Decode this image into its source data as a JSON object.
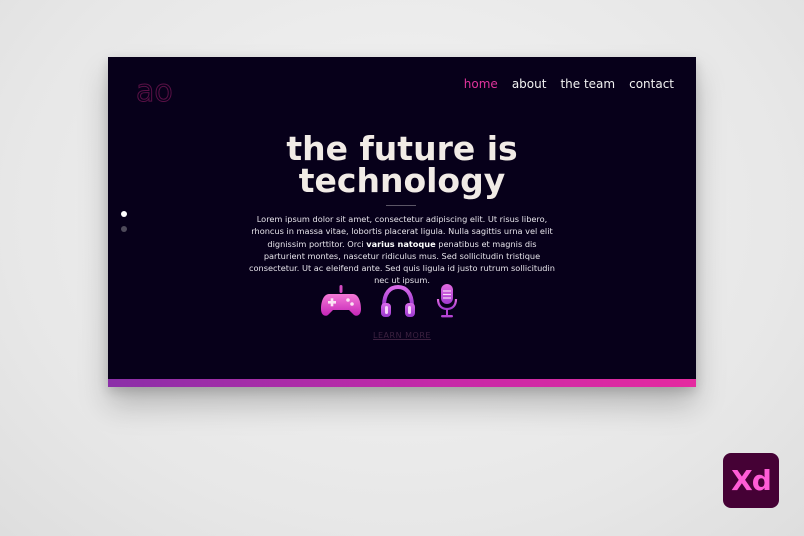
{
  "logo": {
    "text": "ao"
  },
  "nav": {
    "items": [
      {
        "label": "home",
        "active": true
      },
      {
        "label": "about",
        "active": false
      },
      {
        "label": "the team",
        "active": false
      },
      {
        "label": "contact",
        "active": false
      }
    ]
  },
  "hero": {
    "headline_line1": "the future is",
    "headline_line2": "technology",
    "body_part1": "Lorem ipsum dolor sit amet, consectetur adipiscing elit. Ut risus libero, rhoncus in massa vitae, lobortis placerat ligula. Nulla sagittis urna vel elit dignissim porttitor. Orci ",
    "body_bold": "varius natoque",
    "body_part2": " penatibus et magnis dis parturient montes, nascetur ridiculus mus. Sed sollicitudin tristique consectetur. Ut ac eleifend ante. Sed quis ligula id justo rutrum sollicitudin nec ut ipsum.",
    "cta_label": "LEARN MORE"
  },
  "slider": {
    "count": 2,
    "active_index": 0
  },
  "icons": [
    "gamepad-icon",
    "headphones-icon",
    "microphone-icon"
  ],
  "colors": {
    "background": "#07001a",
    "accent": "#e0339c",
    "gradient_start": "#8b2fa8",
    "gradient_end": "#e52aa0"
  },
  "badge": {
    "text": "Xd"
  }
}
